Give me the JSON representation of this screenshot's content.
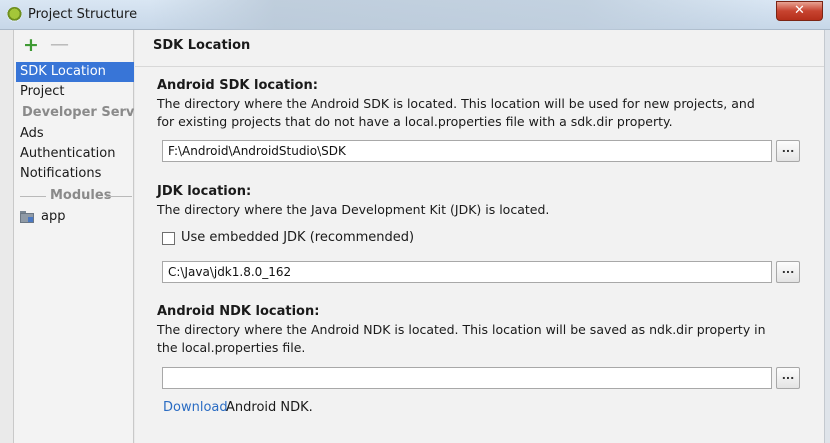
{
  "window": {
    "title": "Project Structure",
    "close_label": "✕",
    "icons": {
      "app": "android-studio-icon",
      "close": "close-icon"
    }
  },
  "sidebar": {
    "toolbar": {
      "add_label": "+",
      "remove_label": "—"
    },
    "items": [
      {
        "label": "SDK Location",
        "selected": true
      },
      {
        "label": "Project",
        "selected": false
      },
      {
        "label": "Developer Servi...",
        "type": "group-header"
      },
      {
        "label": "Ads",
        "selected": false
      },
      {
        "label": "Authentication",
        "selected": false
      },
      {
        "label": "Notifications",
        "selected": false
      }
    ],
    "modules_header": "Modules",
    "modules": [
      {
        "label": "app",
        "icon": "module-folder-icon"
      }
    ]
  },
  "main": {
    "section_title": "SDK Location",
    "android_sdk": {
      "label": "Android SDK location:",
      "description": "The directory where the Android SDK is located. This location will be used for new projects, and for existing projects that do not have a local.properties file with a sdk.dir property.",
      "value": "F:\\Android\\AndroidStudio\\SDK",
      "browse_label": "..."
    },
    "jdk": {
      "label": "JDK location:",
      "description": "The directory where the Java Development Kit (JDK) is located.",
      "embedded_checkbox_label": "Use embedded JDK (recommended)",
      "embedded_checked": false,
      "value": "C:\\Java\\jdk1.8.0_162",
      "browse_label": "..."
    },
    "ndk": {
      "label": "Android NDK location:",
      "description": "The directory where the Android NDK is located. This location will be saved as ndk.dir property in the local.properties file.",
      "value": "",
      "browse_label": "...",
      "download_link": "Download",
      "download_suffix": "Android NDK."
    }
  },
  "colors": {
    "selection": "#3875d7",
    "link": "#2a6cc3",
    "add_icon": "#3e9a33"
  }
}
